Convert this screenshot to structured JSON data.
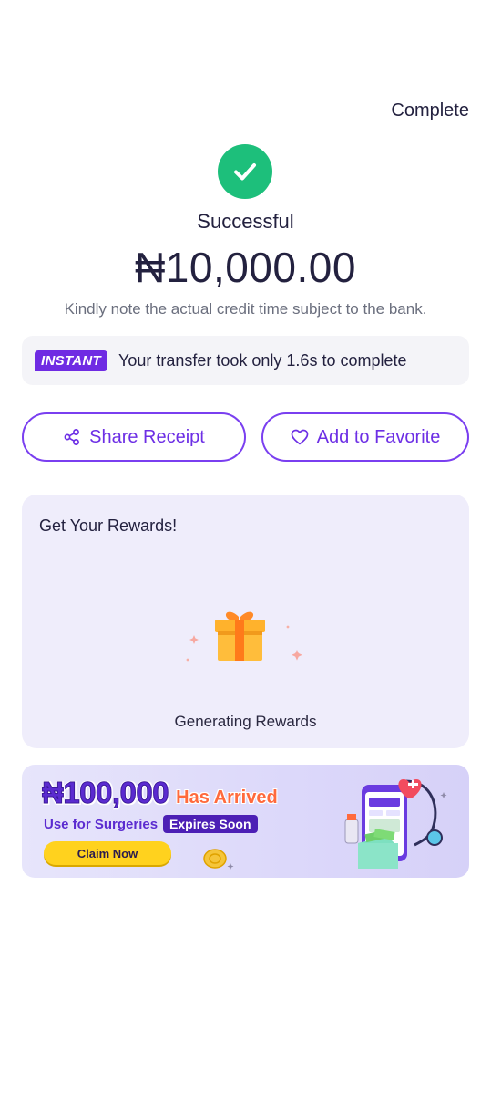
{
  "header": {
    "complete_label": "Complete"
  },
  "result": {
    "status": "Successful",
    "amount": "₦10,000.00",
    "note": "Kindly note the actual credit time subject to the bank."
  },
  "instant": {
    "badge": "INSTANT",
    "text": "Your transfer took only 1.6s to complete"
  },
  "actions": {
    "share_label": "Share Receipt",
    "favorite_label": "Add to Favorite"
  },
  "rewards": {
    "title": "Get Your Rewards!",
    "status": "Generating Rewards"
  },
  "banner": {
    "amount": "₦100,000",
    "headline": "Has Arrived",
    "subtitle": "Use for Surgeries",
    "badge": "Expires Soon",
    "cta": "Claim Now"
  },
  "colors": {
    "success": "#1dbf7b",
    "accent": "#7a3ff0",
    "badge": "#6f2be3",
    "gift": "#ffb22c"
  },
  "icons": [
    "check-icon",
    "share-icon",
    "heart-icon",
    "gift-icon"
  ]
}
